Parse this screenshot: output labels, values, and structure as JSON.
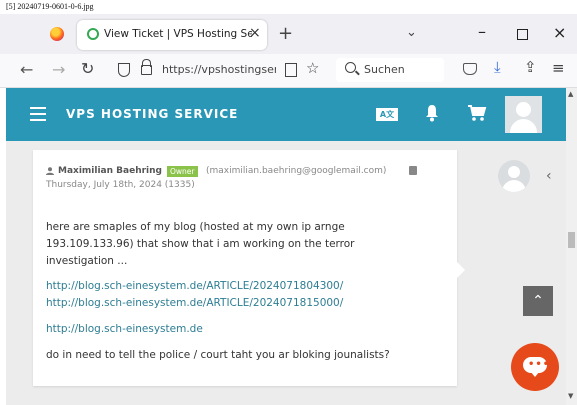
{
  "caption": "[5] 20240719-0601-0-6.jpg",
  "browser": {
    "tab_title": "View Ticket | VPS Hosting Servic",
    "tab_close": "×",
    "new_tab": "+",
    "tabs_dropdown": "⌄",
    "url": "https://vpshostingserv",
    "search_placeholder": "Suchen",
    "window": {
      "minimize": "–",
      "close": "×"
    }
  },
  "site": {
    "brand": "VPS HOSTING SERVICE",
    "lang_label": "A文"
  },
  "ticket": {
    "author": "Maximilian Baehring",
    "badge": "Owner",
    "email": "(maximilian.baehring@googlemail.com)",
    "date": "Thursday, July 18th, 2024 (1335)",
    "message": "here are smaples of my blog (hosted at my own ip arnge 193.109.133.96) that show that i am working on the terror investigation ...",
    "links": [
      "http://blog.sch-einesystem.de/ARTICLE/2024071804300/",
      "http://blog.sch-einesystem.de/ARTICLE/2024071815000/",
      "http://blog.sch-einesystem.de"
    ],
    "question": "do in need to tell the police / court taht you ar bloking jounalists?"
  },
  "colors": {
    "header": "#2b97b6",
    "owner_badge": "#8bc34a",
    "link": "#2d7d93",
    "chat_button": "#e64a1a"
  }
}
